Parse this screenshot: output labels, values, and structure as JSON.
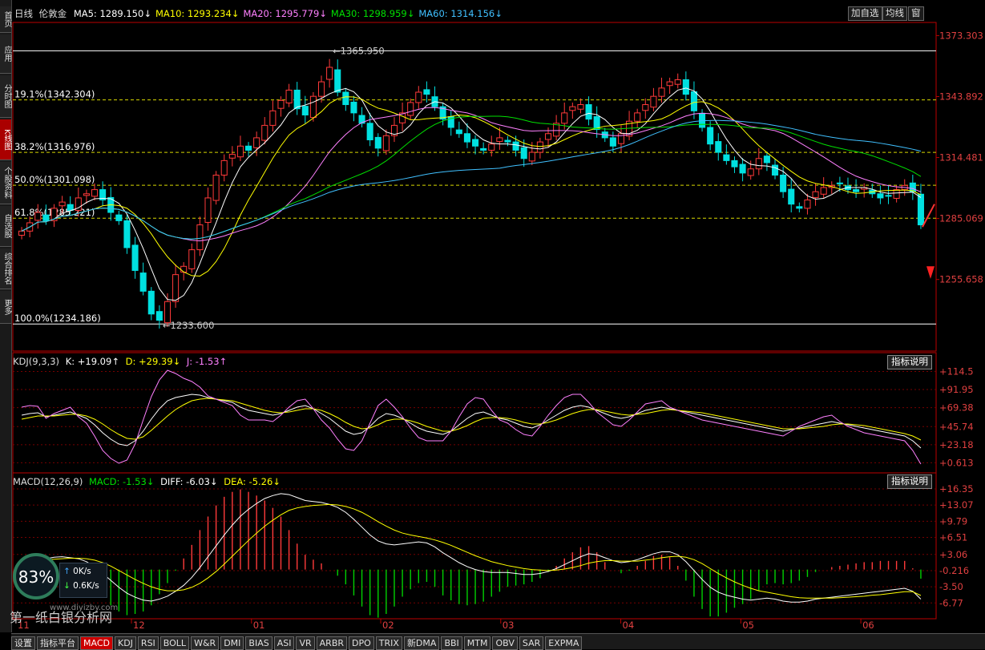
{
  "window": {
    "add_watch": "加自选",
    "avg_line": "均线",
    "window_btn": "窗"
  },
  "sidebar": {
    "tabs": [
      "首页",
      "应用",
      "分时图",
      "K线图",
      "个股资料",
      "自选股",
      "综合排名",
      "更多"
    ],
    "active_index": 3
  },
  "colors": {
    "up": "#ff3a3a",
    "down": "#00e0e0",
    "ma5": "#ffffff",
    "ma10": "#ffff00",
    "ma20": "#ff80ff",
    "ma30": "#00e000",
    "ma60": "#40c0ff",
    "kdj_k": "#ffffff",
    "kdj_d": "#ffff00",
    "kdj_j": "#ff80ff",
    "macd_pos": "#ff3a3a",
    "macd_neg": "#00d000",
    "fib": "#d8d800"
  },
  "main_panel": {
    "period": "日线",
    "symbol": "伦敦金",
    "ma_labels": [
      {
        "text": "MA5: 1289.150↓",
        "color": "#ffffff"
      },
      {
        "text": "MA10: 1293.234↓",
        "color": "#ffff00"
      },
      {
        "text": "MA20: 1295.779↓",
        "color": "#ff80ff"
      },
      {
        "text": "MA30: 1298.959↓",
        "color": "#00e000"
      },
      {
        "text": "MA60: 1314.156↓",
        "color": "#40c0ff"
      }
    ],
    "fib_levels": [
      {
        "label": "",
        "value": 1365.95
      },
      {
        "label": "19.1%(1342.304)",
        "value": 1342.304
      },
      {
        "label": "38.2%(1316.976)",
        "value": 1316.976
      },
      {
        "label": "50.0%(1301.098)",
        "value": 1301.098
      },
      {
        "label": "61.8%(1285.221)",
        "value": 1285.221
      },
      {
        "label": "100.0%(1234.186)",
        "value": 1234.186
      }
    ],
    "high_marker": "1365.950",
    "low_marker": "1233.600",
    "price_axis": [
      "1373.303",
      "1343.892",
      "1314.481",
      "1285.069",
      "1255.658"
    ]
  },
  "kdj_panel": {
    "title": "KDJ(9,3,3)",
    "k_label": "K: +19.09↑",
    "d_label": "D: +29.39↓",
    "j_label": "J: -1.53↑",
    "explain": "指标说明",
    "axis": [
      "+114.5",
      "+91.95",
      "+69.38",
      "+45.74",
      "+23.18",
      "+0.613"
    ]
  },
  "macd_panel": {
    "title": "MACD(12,26,9)",
    "macd_label": "MACD: -1.53↓",
    "diff_label": "DIFF: -6.03↓",
    "dea_label": "DEA: -5.26↓",
    "explain": "指标说明",
    "axis": [
      "+16.35",
      "+13.07",
      "+9.79",
      "+6.51",
      "+3.06",
      "-0.216",
      "-3.50",
      "-6.77"
    ]
  },
  "x_axis_months": [
    "11",
    "12",
    "01",
    "02",
    "03",
    "04",
    "05",
    "06"
  ],
  "bottom_tabs": [
    "设置",
    "指标平台",
    "MACD",
    "KDJ",
    "RSI",
    "BOLL",
    "W&R",
    "DMI",
    "BIAS",
    "ASI",
    "VR",
    "ARBR",
    "DPO",
    "TRIX",
    "新DMA",
    "BBI",
    "MTM",
    "OBV",
    "SAR",
    "EXPMA"
  ],
  "bottom_active": 2,
  "overlay": {
    "gauge": "83%",
    "up_speed": "0K/s",
    "down_speed": "0.6K/s",
    "watermark": "第一纸白银分析网",
    "watermark_url": "www.diyizby.com"
  },
  "chart_data": {
    "type": "candlestick",
    "price_range": [
      1225,
      1375
    ],
    "kdj_range": [
      -8,
      120
    ],
    "macd_range": [
      -9,
      17
    ],
    "close": [
      1279,
      1283,
      1288,
      1284,
      1290,
      1293,
      1289,
      1295,
      1297,
      1299,
      1294,
      1288,
      1284,
      1271,
      1260,
      1250,
      1239,
      1236,
      1245,
      1258,
      1262,
      1270,
      1282,
      1295,
      1306,
      1313,
      1316,
      1320,
      1318,
      1324,
      1330,
      1337,
      1342,
      1347,
      1338,
      1335,
      1344,
      1351,
      1358,
      1346,
      1340,
      1336,
      1331,
      1323,
      1319,
      1325,
      1330,
      1336,
      1341,
      1346,
      1345,
      1339,
      1333,
      1329,
      1326,
      1322,
      1320,
      1318,
      1321,
      1324,
      1322,
      1318,
      1314,
      1317,
      1322,
      1326,
      1331,
      1336,
      1339,
      1340,
      1333,
      1328,
      1324,
      1320,
      1326,
      1332,
      1336,
      1340,
      1344,
      1348,
      1351,
      1352,
      1345,
      1337,
      1329,
      1321,
      1317,
      1313,
      1310,
      1307,
      1309,
      1314,
      1312,
      1306,
      1298,
      1292,
      1290,
      1294,
      1298,
      1300,
      1301,
      1302,
      1299,
      1298,
      1300,
      1297,
      1295,
      1296,
      1299,
      1301,
      1298,
      1282
    ],
    "kdj_k": [
      60,
      62,
      63,
      58,
      60,
      62,
      64,
      60,
      56,
      48,
      38,
      30,
      24,
      22,
      28,
      40,
      55,
      68,
      78,
      82,
      84,
      86,
      85,
      82,
      80,
      78,
      76,
      70,
      66,
      64,
      62,
      60,
      62,
      66,
      70,
      72,
      68,
      62,
      56,
      48,
      40,
      36,
      38,
      46,
      56,
      62,
      60,
      56,
      50,
      44,
      40,
      38,
      36,
      40,
      48,
      56,
      62,
      64,
      60,
      56,
      54,
      50,
      46,
      44,
      48,
      54,
      60,
      66,
      70,
      72,
      70,
      66,
      62,
      58,
      56,
      58,
      62,
      66,
      68,
      70,
      68,
      66,
      64,
      62,
      60,
      58,
      56,
      54,
      52,
      50,
      48,
      46,
      44,
      42,
      40,
      42,
      44,
      46,
      48,
      50,
      52,
      50,
      48,
      46,
      44,
      42,
      40,
      38,
      36,
      34,
      28,
      19
    ],
    "kdj_d": [
      55,
      57,
      59,
      59,
      59,
      60,
      61,
      61,
      59,
      55,
      49,
      42,
      36,
      31,
      30,
      33,
      41,
      50,
      59,
      67,
      73,
      78,
      80,
      81,
      80,
      79,
      78,
      75,
      72,
      69,
      66,
      64,
      63,
      64,
      66,
      68,
      68,
      66,
      62,
      57,
      51,
      46,
      43,
      44,
      48,
      53,
      55,
      55,
      53,
      50,
      46,
      43,
      40,
      40,
      43,
      47,
      52,
      56,
      57,
      57,
      56,
      54,
      51,
      49,
      49,
      51,
      54,
      58,
      62,
      65,
      67,
      67,
      65,
      63,
      61,
      60,
      61,
      62,
      64,
      66,
      67,
      66,
      65,
      64,
      63,
      61,
      59,
      57,
      55,
      53,
      51,
      49,
      47,
      45,
      43,
      43,
      43,
      44,
      45,
      46,
      48,
      49,
      49,
      48,
      47,
      45,
      43,
      41,
      39,
      37,
      34,
      29
    ],
    "macd_diff": [
      1.8,
      2.1,
      2.4,
      2.2,
      2.5,
      2.6,
      2.4,
      2.2,
      1.6,
      0.6,
      -0.8,
      -2.2,
      -3.6,
      -4.8,
      -5.6,
      -6.2,
      -6.4,
      -6.0,
      -5.4,
      -4.4,
      -3.2,
      -1.6,
      0.4,
      2.6,
      4.8,
      7.0,
      9.0,
      10.8,
      12.2,
      13.4,
      14.4,
      15.0,
      15.4,
      15.2,
      14.6,
      14.0,
      13.8,
      13.6,
      13.2,
      12.6,
      11.6,
      10.2,
      8.6,
      7.0,
      5.8,
      5.2,
      5.0,
      5.2,
      5.4,
      5.6,
      5.4,
      4.6,
      3.4,
      2.4,
      1.4,
      0.6,
      0.0,
      -0.4,
      -0.6,
      -0.6,
      -0.6,
      -0.8,
      -1.0,
      -1.0,
      -0.8,
      -0.4,
      0.2,
      1.0,
      1.8,
      2.6,
      3.2,
      3.0,
      2.4,
      1.8,
      1.4,
      1.6,
      2.0,
      2.6,
      3.2,
      3.6,
      3.6,
      3.0,
      1.6,
      -0.2,
      -2.0,
      -3.6,
      -4.6,
      -5.2,
      -5.6,
      -6.0,
      -6.2,
      -6.0,
      -5.8,
      -6.0,
      -6.4,
      -6.6,
      -6.6,
      -6.4,
      -6.0,
      -5.8,
      -5.6,
      -5.4,
      -5.2,
      -5.0,
      -4.8,
      -4.6,
      -4.4,
      -4.2,
      -4.0,
      -3.8,
      -4.4,
      -6.0
    ],
    "macd_dea": [
      1.5,
      1.7,
      1.9,
      2.0,
      2.1,
      2.2,
      2.3,
      2.3,
      2.2,
      1.9,
      1.4,
      0.7,
      -0.2,
      -1.1,
      -2.0,
      -2.8,
      -3.5,
      -4.0,
      -4.3,
      -4.3,
      -4.1,
      -3.6,
      -2.8,
      -1.7,
      -0.4,
      1.1,
      2.7,
      4.3,
      5.9,
      7.4,
      8.8,
      10.0,
      11.1,
      12.0,
      12.5,
      12.8,
      13.0,
      13.1,
      13.2,
      13.1,
      12.8,
      12.3,
      11.6,
      10.7,
      9.7,
      8.8,
      8.0,
      7.4,
      7.0,
      6.7,
      6.4,
      6.0,
      5.5,
      4.9,
      4.2,
      3.5,
      2.8,
      2.2,
      1.6,
      1.2,
      0.8,
      0.5,
      0.2,
      0.0,
      -0.1,
      -0.2,
      -0.1,
      0.1,
      0.4,
      0.8,
      1.3,
      1.6,
      1.8,
      1.8,
      1.7,
      1.7,
      1.7,
      1.9,
      2.1,
      2.4,
      2.6,
      2.7,
      2.5,
      2.0,
      1.2,
      0.2,
      -0.8,
      -1.7,
      -2.5,
      -3.2,
      -3.8,
      -4.3,
      -4.6,
      -4.9,
      -5.2,
      -5.5,
      -5.7,
      -5.8,
      -5.8,
      -5.8,
      -5.8,
      -5.7,
      -5.6,
      -5.5,
      -5.4,
      -5.2,
      -5.1,
      -4.9,
      -4.7,
      -4.5,
      -4.5,
      -5.26
    ]
  }
}
